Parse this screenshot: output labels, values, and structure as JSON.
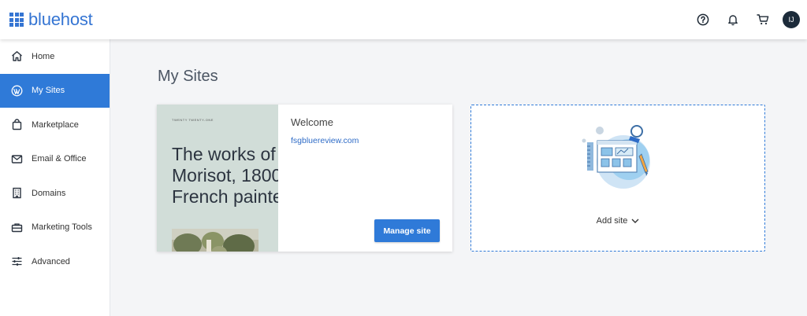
{
  "brand": {
    "name": "bluehost",
    "color": "#3575d3"
  },
  "header": {
    "icons": [
      "help-icon",
      "bell-icon",
      "cart-icon"
    ],
    "avatar_initials": "IJ"
  },
  "sidebar": {
    "items": [
      {
        "label": "Home",
        "icon": "home-icon",
        "active": false
      },
      {
        "label": "My Sites",
        "icon": "wordpress-icon",
        "active": true
      },
      {
        "label": "Marketplace",
        "icon": "shopping-bag-icon",
        "active": false
      },
      {
        "label": "Email & Office",
        "icon": "envelope-icon",
        "active": false
      },
      {
        "label": "Domains",
        "icon": "building-icon",
        "active": false
      },
      {
        "label": "Marketing Tools",
        "icon": "toolbox-icon",
        "active": false
      },
      {
        "label": "Advanced",
        "icon": "sliders-icon",
        "active": false
      }
    ],
    "active_color": "#2f7ad8"
  },
  "main": {
    "title": "My Sites",
    "site_card": {
      "thumb_theme": "TWENTY TWENTY-ONE",
      "thumb_headline": "The works of\nMorisot, 1800\nFrench painte",
      "welcome": "Welcome",
      "domain": "fsgbluereview.com",
      "manage_label": "Manage site"
    },
    "add_card": {
      "label": "Add site"
    }
  }
}
